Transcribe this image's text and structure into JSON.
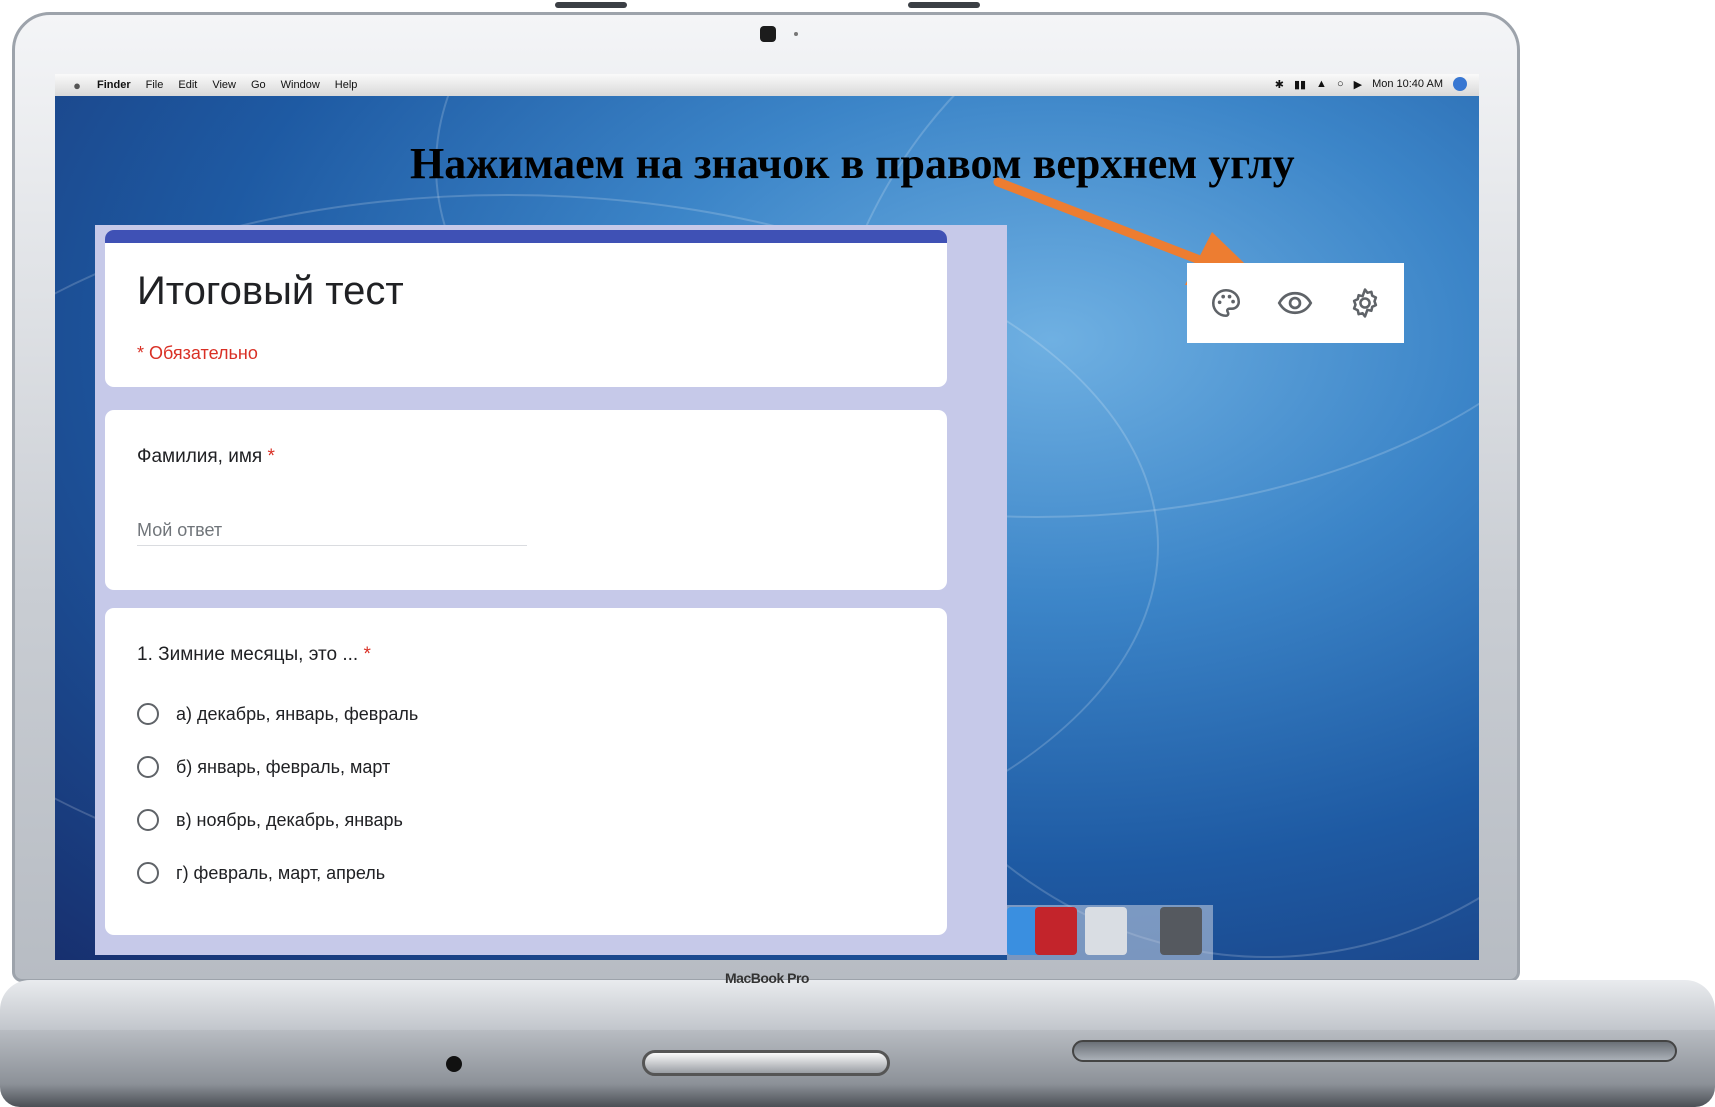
{
  "menubar": {
    "apple_icon": "apple-icon",
    "items": [
      "Finder",
      "File",
      "Edit",
      "View",
      "Go",
      "Window",
      "Help"
    ],
    "clock": "Mon 10:40 AM"
  },
  "annotation": {
    "text": "Нажимаем на значок в правом верхнем углу",
    "arrow_color": "#ed7d31"
  },
  "form": {
    "accent_color": "#3f51b5",
    "background_color": "#c6c9e9",
    "title": "Итоговый тест",
    "required_note": "* Обязательно",
    "question1": {
      "label": "Фамилия, имя",
      "required_mark": "*",
      "placeholder": "Мой ответ"
    },
    "question2": {
      "label": "1. Зимние месяцы, это ...",
      "required_mark": "*",
      "options": [
        "а) декабрь, январь, февраль",
        "б) январь, февраль, март",
        "в) ноябрь, декабрь, январь",
        "г) февраль, март, апрель"
      ]
    }
  },
  "toolbar": {
    "icons": [
      "palette-icon",
      "eye-icon",
      "gear-icon"
    ]
  },
  "laptop": {
    "brand": "MacBook Pro"
  }
}
